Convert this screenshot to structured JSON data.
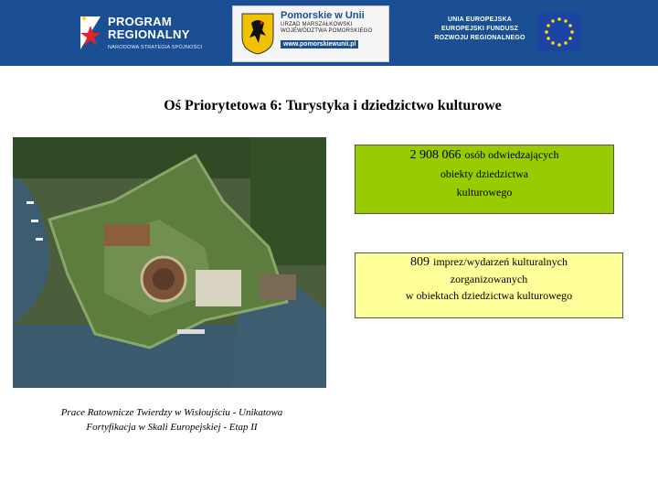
{
  "header": {
    "program": {
      "line1": "PROGRAM",
      "line2": "REGIONALNY",
      "line3": "NARODOWA STRATEGIA SPÓJNOŚCI"
    },
    "pomorskie": {
      "title": "Pomorskie w Unii",
      "line2": "URZĄD MARSZAŁKOWSKI",
      "line3": "WOJEWÓDZTWA POMORSKIEGO",
      "url": "www.pomorskiewunii.pl"
    },
    "eu": {
      "line1": "UNIA EUROPEJSKA",
      "line2": "EUROPEJSKI FUNDUSZ",
      "line3": "ROZWOJU REGIONALNEGO"
    },
    "colors": {
      "banner": "#1a4f93",
      "eu_flag": "#1c44a3",
      "star": "#ffdd00"
    }
  },
  "slide": {
    "title": "Oś Priorytetowa 6: Turystyka i dziedzictwo kulturowe"
  },
  "photo": {
    "caption_line1": "Prace Ratownicze Twierdzy w Wisłoujściu - Unikatowa",
    "caption_line2": "Fortyfikacja w Skali Europejskiej - Etap II"
  },
  "stats": [
    {
      "value": "2 908 066",
      "line1": "osób odwiedzających",
      "line2": "obiekty dziedzictwa",
      "line3": "kulturowego",
      "color": "#99cc00"
    },
    {
      "value": "809",
      "line1": "imprez/wydarzeń kulturalnych",
      "line2": "zorganizowanych",
      "line3": "w obiektach dziedzictwa kulturowego",
      "color": "#ffff99"
    }
  ]
}
